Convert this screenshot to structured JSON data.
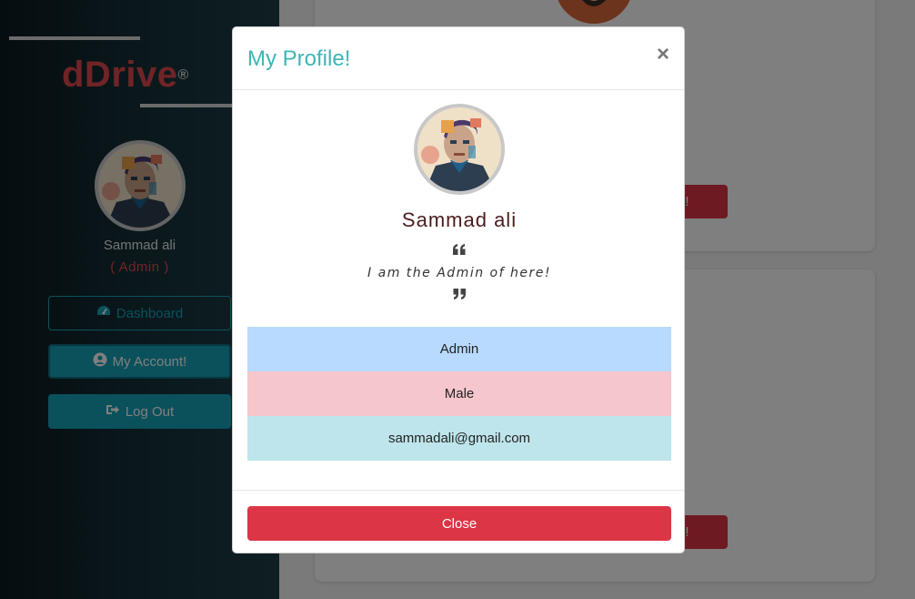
{
  "sidebar": {
    "brand": "dDrive",
    "brand_mark": "®",
    "user_name": "Sammad ali",
    "user_role": "( Admin )",
    "nav": [
      {
        "label": "Dashboard",
        "icon": "tachometer-icon"
      },
      {
        "label": "My Account!",
        "icon": "user-circle-icon"
      },
      {
        "label": "Log Out",
        "icon": "sign-out-icon"
      }
    ]
  },
  "main": {
    "card_buttons": [
      "ser!",
      "ser!"
    ]
  },
  "modal": {
    "title": "My Profile!",
    "close_symbol": "×",
    "name": "Sammad ali",
    "bio": "I am the Admin of here!",
    "items": [
      {
        "value": "Admin",
        "color": "#b8daff"
      },
      {
        "value": "Male",
        "color": "#f5c6cb"
      },
      {
        "value": "sammadali@gmail.com",
        "color": "#bee5eb"
      }
    ],
    "close_label": "Close"
  },
  "colors": {
    "accent": "#17a2b8",
    "danger": "#dc3545",
    "brand": "#e0484e",
    "title": "#3fb5b5"
  }
}
